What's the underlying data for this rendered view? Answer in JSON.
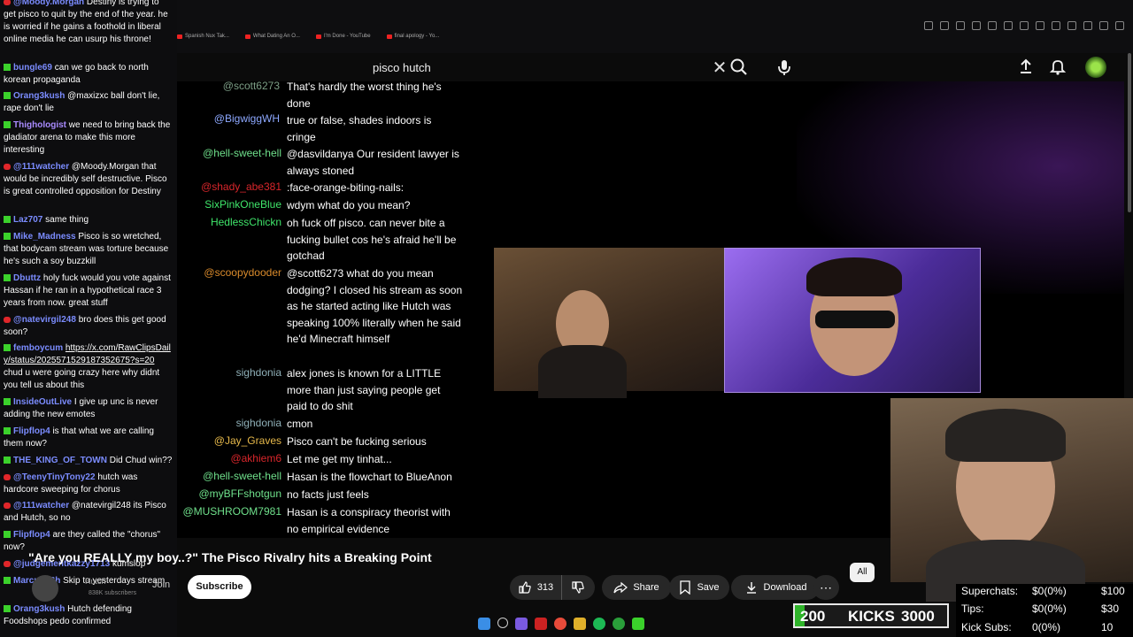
{
  "browser": {
    "bookmarks": [
      {
        "label": "Spanish Nux Tak..."
      },
      {
        "label": "What Dating An O..."
      },
      {
        "label": "I'm Done - YouTube"
      },
      {
        "label": "final apology - Yo..."
      }
    ]
  },
  "search": {
    "query": "pisco hutch",
    "clear_icon": "close-icon",
    "search_icon": "search-icon",
    "mic_icon": "mic-icon"
  },
  "header_icons": {
    "upload": "upload-icon",
    "bell": "bell-icon"
  },
  "left_chat": [
    {
      "badge": "youtube",
      "user": "@Moody.Morgan",
      "user_color": "#7b8cff",
      "text": "Destiny is trying to get pisco to quit by the end of the year. he is worried if he gains a foothold in liberal online media he can usurp his throne!"
    },
    {
      "badge": "kick",
      "user": "bungle69",
      "user_color": "#7b8cff",
      "text": "can we go back to north korean propaganda"
    },
    {
      "badge": "kick",
      "user": "Orang3kush",
      "user_color": "#7b8cff",
      "text": "@maxizxc ball don't lie, rape don't lie"
    },
    {
      "badge": "kick",
      "user": "Thighologist",
      "user_color": "#a98bff",
      "text": "we need to bring back the gladiator arena to make this more interesting"
    },
    {
      "badge": "youtube",
      "user": "@111watcher",
      "user_color": "#7b8cff",
      "text": "@Moody.Morgan that would be incredibly self destructive. Pisco is great controlled opposition for Destiny"
    },
    {
      "badge": "kick",
      "user": "Laz707",
      "user_color": "#7b8cff",
      "text": "same thing"
    },
    {
      "badge": "kick",
      "user": "Mike_Madness",
      "user_color": "#7b8cff",
      "text": "Pisco is so wretched, that bodycam stream was torture because he's such a soy buzzkill"
    },
    {
      "badge": "kick",
      "user": "Dbuttz",
      "user_color": "#7b8cff",
      "text": "holy fuck would you vote against Hassan if he ran in a hypothetical race 3 years from now. great stuff"
    },
    {
      "badge": "youtube",
      "user": "@natevirgil248",
      "user_color": "#7b8cff",
      "text": "bro does this get good soon?"
    },
    {
      "badge": "kick",
      "user": "femboycum",
      "user_color": "#7b8cff",
      "link": "https://x.com/RawClipsDaily/status/2025571529187352675?s=20",
      "text": "chud u were going crazy here why didnt you tell us about this"
    },
    {
      "badge": "kick",
      "user": "InsideOutLive",
      "user_color": "#7b8cff",
      "text": "I give up unc is never adding the new emotes"
    },
    {
      "badge": "kick",
      "user": "Flipflop4",
      "user_color": "#7b8cff",
      "text": "is that what we are calling them now?"
    },
    {
      "badge": "kick",
      "user": "THE_KING_OF_TOWN",
      "user_color": "#7b8cff",
      "text": "Did Chud win??"
    },
    {
      "badge": "youtube",
      "user": "@TeenyTinyTony22",
      "user_color": "#7b8cff",
      "text": "hutch was hardcore sweeping for chorus"
    },
    {
      "badge": "youtube",
      "user": "@111watcher",
      "user_color": "#7b8cff",
      "text": "@natevirgil248 its Pisco and Hutch, so no"
    },
    {
      "badge": "kick",
      "user": "Flipflop4",
      "user_color": "#7b8cff",
      "text": "are they called the \"chorus\" now?"
    },
    {
      "badge": "youtube",
      "user": "@judgementkazzy1713",
      "user_color": "#7b8cff",
      "text": "kumslop"
    },
    {
      "badge": "kick",
      "user": "Marcus_Sh",
      "user_color": "#7b8cff",
      "text": "Skip to yesterdays stream"
    },
    {
      "badge": "kick",
      "user": "Orang3kush",
      "user_color": "#7b8cff",
      "text": "Hutch defending Foodshops pedo confirmed"
    }
  ],
  "video_chat": [
    {
      "user": "@scott6273",
      "user_color": "#7c9e86",
      "text": "That's hardly the worst thing he's done"
    },
    {
      "user": "@BigwiggWH",
      "user_color": "#8da8ff",
      "text": "true or false, shades indoors is cringe"
    },
    {
      "user": "@hell-sweet-hell",
      "user_color": "#6fe08b",
      "text": "@dasvildanya Our resident lawyer is always stoned"
    },
    {
      "user": "@shady_abe381",
      "user_color": "#d9262b",
      "text": ":face-orange-biting-nails:"
    },
    {
      "user": "SixPinkOneBlue",
      "user_color": "#3fe46a",
      "text": "wdym what do you mean?"
    },
    {
      "user": "HedlessChickn",
      "user_color": "#3fe46a",
      "text": "oh fuck off pisco. can never bite a fucking bullet cos he's afraid he'll be gotchad"
    },
    {
      "user": "@scoopydooder",
      "user_color": "#d98a2b",
      "text": "@scott6273 what do you mean dodging? I closed his stream as soon as he started acting like Hutch was speaking 100% literally when he said he'd Minecraft himself"
    },
    {
      "user": "sighdonia",
      "user_color": "#8fb0b8",
      "text": "alex jones is known for a LITTLE more than just saying people get paid to do shit"
    },
    {
      "user": "sighdonia",
      "user_color": "#8fb0b8",
      "text": "cmon"
    },
    {
      "user": "@Jay_Graves",
      "user_color": "#e6b84a",
      "text": "Pisco can't be fucking serious"
    },
    {
      "user": "@akhiem6",
      "user_color": "#d9262b",
      "text": "Let me get my tinhat..."
    },
    {
      "user": "@hell-sweet-hell",
      "user_color": "#6fe08b",
      "text": "Hasan is the flowchart to BlueAnon"
    },
    {
      "user": "@myBFFshotgun",
      "user_color": "#6fe08b",
      "text": "no facts just feels"
    },
    {
      "user": "@MUSHROOM7981",
      "user_color": "#6fe08b",
      "text": "Hasan is a conspiracy theorist with no empirical evidence"
    }
  ],
  "video": {
    "title": "\"Are you REALLY my boy..?\" The Pisco Rivalry hits a Breaking Point",
    "channel_name": "Hutch",
    "subscribers": "838K subscribers",
    "join_label": "Join",
    "subscribe_label": "Subscribe",
    "likes": "313",
    "share_label": "Share",
    "save_label": "Save",
    "download_label": "Download",
    "more_label": "⋯",
    "chip_all": "All"
  },
  "stats": {
    "superchats": {
      "label": "Superchats:",
      "value": "$0(0%)",
      "goal": "$100"
    },
    "tips": {
      "label": "Tips:",
      "value": "$0(0%)",
      "goal": "$30"
    },
    "kick_subs": {
      "label": "Kick Subs:",
      "value": "0(0%)",
      "goal": "10"
    }
  },
  "kicks": {
    "current": "200",
    "label": "KICKS",
    "goal": "3000",
    "progress_fraction": 0.0667,
    "fill_color": "#2fb42a"
  }
}
